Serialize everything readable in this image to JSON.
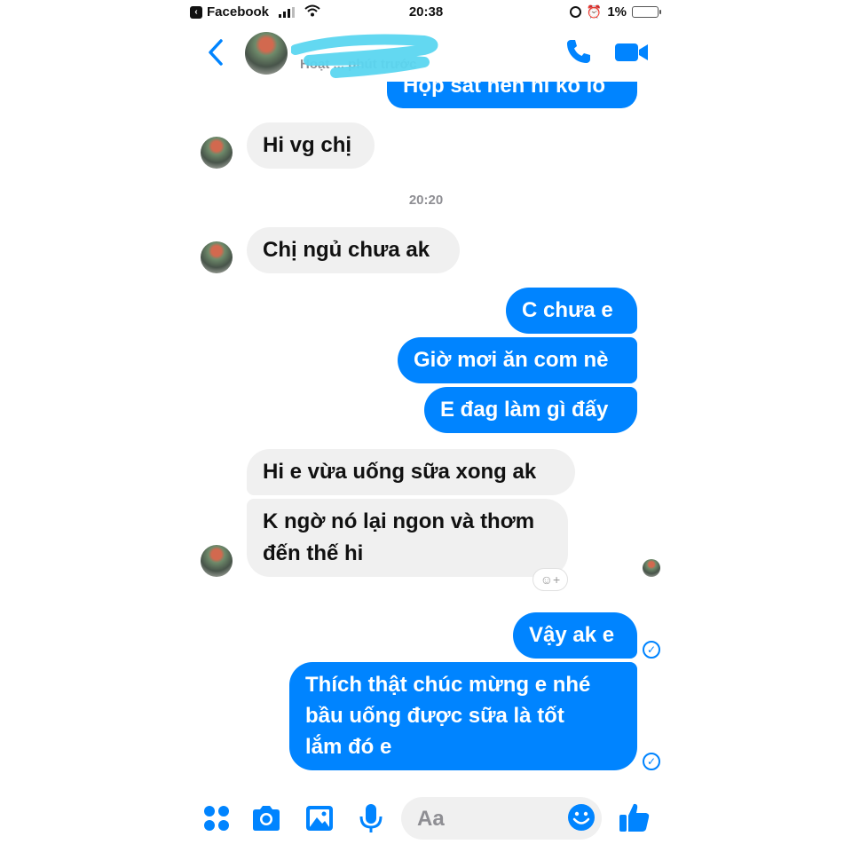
{
  "status_bar": {
    "back_app": "Facebook",
    "time": "20:38",
    "battery": "1%"
  },
  "header": {
    "active_status": "Hoạt ... phút trước"
  },
  "messages": {
    "cut_off_top": "Hộp sắt nên ni ko lo",
    "m1": "Hi vg chị",
    "timestamp": "20:20",
    "m2": "Chị ngủ chưa ak",
    "m3": "C chưa e",
    "m4": "Giờ mơi ăn com nè",
    "m5": "E đag làm gì đấy",
    "m6": "Hi e vừa uống sữa xong ak",
    "m7_line1": "K ngờ nó lại ngon và thơm",
    "m7_line2": "đến thế hi",
    "m8": "Vậy ak e",
    "m9_line1": "Thích thật chúc mừng e nhé",
    "m9_line2": "bầu uống được sữa là tốt",
    "m9_line3": "lắm đó e",
    "react_label": "☺+"
  },
  "composer": {
    "placeholder": "Aa"
  },
  "colors": {
    "accent": "#0084ff",
    "incoming_bubble": "#f0f0f0",
    "meta_text": "#8e8e93"
  },
  "icons": [
    "back-chevron-icon",
    "phone-icon",
    "video-camera-icon",
    "apps-grid-icon",
    "camera-icon",
    "image-icon",
    "microphone-icon",
    "emoji-icon",
    "thumbs-up-icon",
    "sent-check-icon"
  ]
}
